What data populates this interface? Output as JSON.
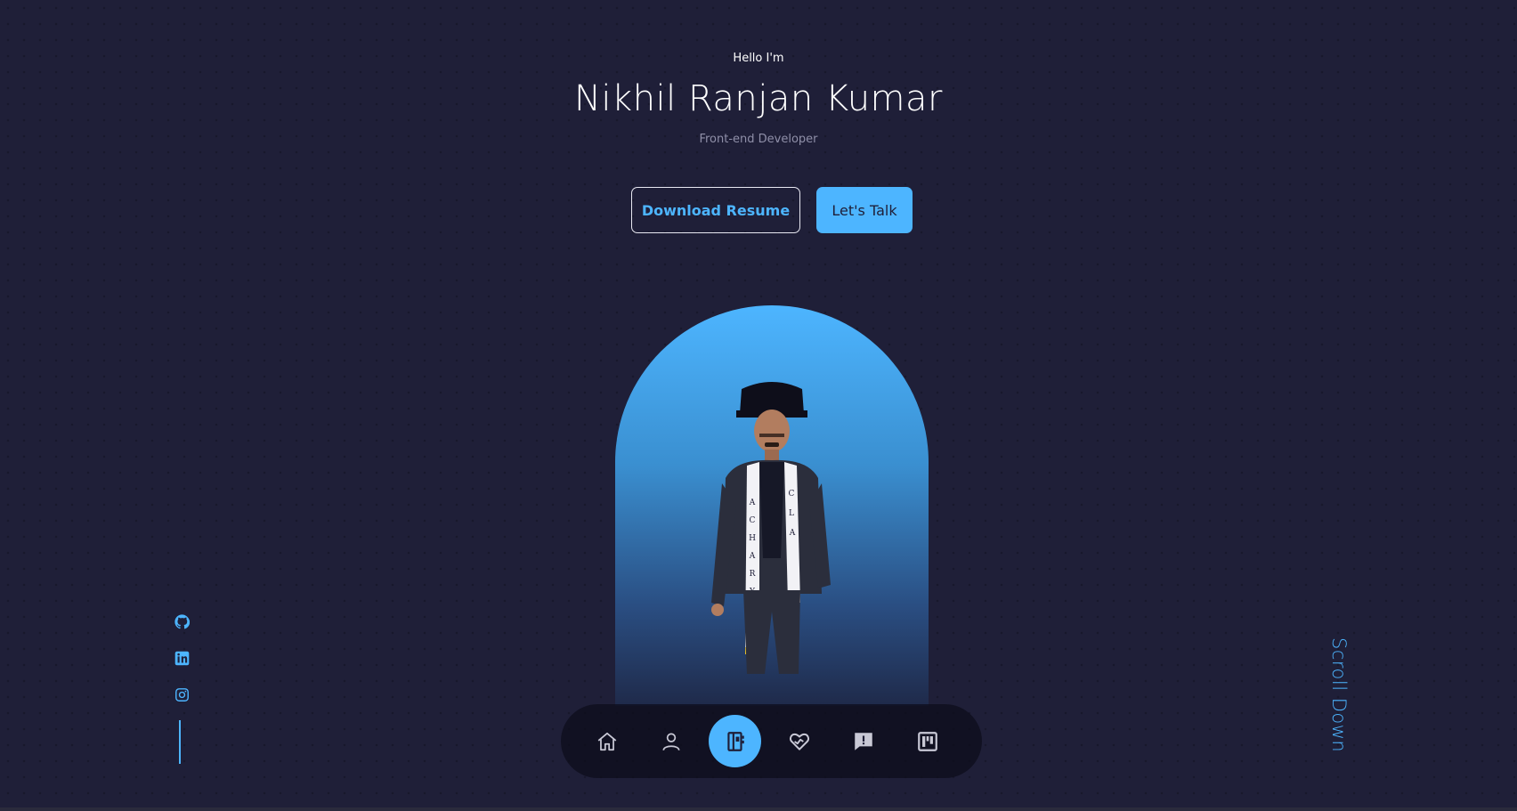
{
  "hero": {
    "greeting": "Hello I'm",
    "name": "Nikhil Ranjan Kumar",
    "role": "Front-end Developer"
  },
  "buttons": {
    "download_label": "Download Resume",
    "talk_label": "Let's Talk"
  },
  "portrait": {
    "description_icon": "person-photo",
    "stole_left_text": "ACHARYA",
    "stole_right_text": "CLAS"
  },
  "socials": [
    {
      "icon": "github-icon"
    },
    {
      "icon": "linkedin-icon"
    },
    {
      "icon": "instagram-icon"
    }
  ],
  "scroll_label": "Scroll Down",
  "nav": [
    {
      "icon": "home-icon",
      "active": false
    },
    {
      "icon": "user-icon",
      "active": false
    },
    {
      "icon": "book-icon",
      "active": true
    },
    {
      "icon": "services-icon",
      "active": false
    },
    {
      "icon": "message-icon",
      "active": false
    },
    {
      "icon": "portfolio-icon",
      "active": false
    }
  ],
  "colors": {
    "background": "#1f1f38",
    "accent": "#4db5ff",
    "text": "#ffffff",
    "muted": "#8f8fa8"
  }
}
